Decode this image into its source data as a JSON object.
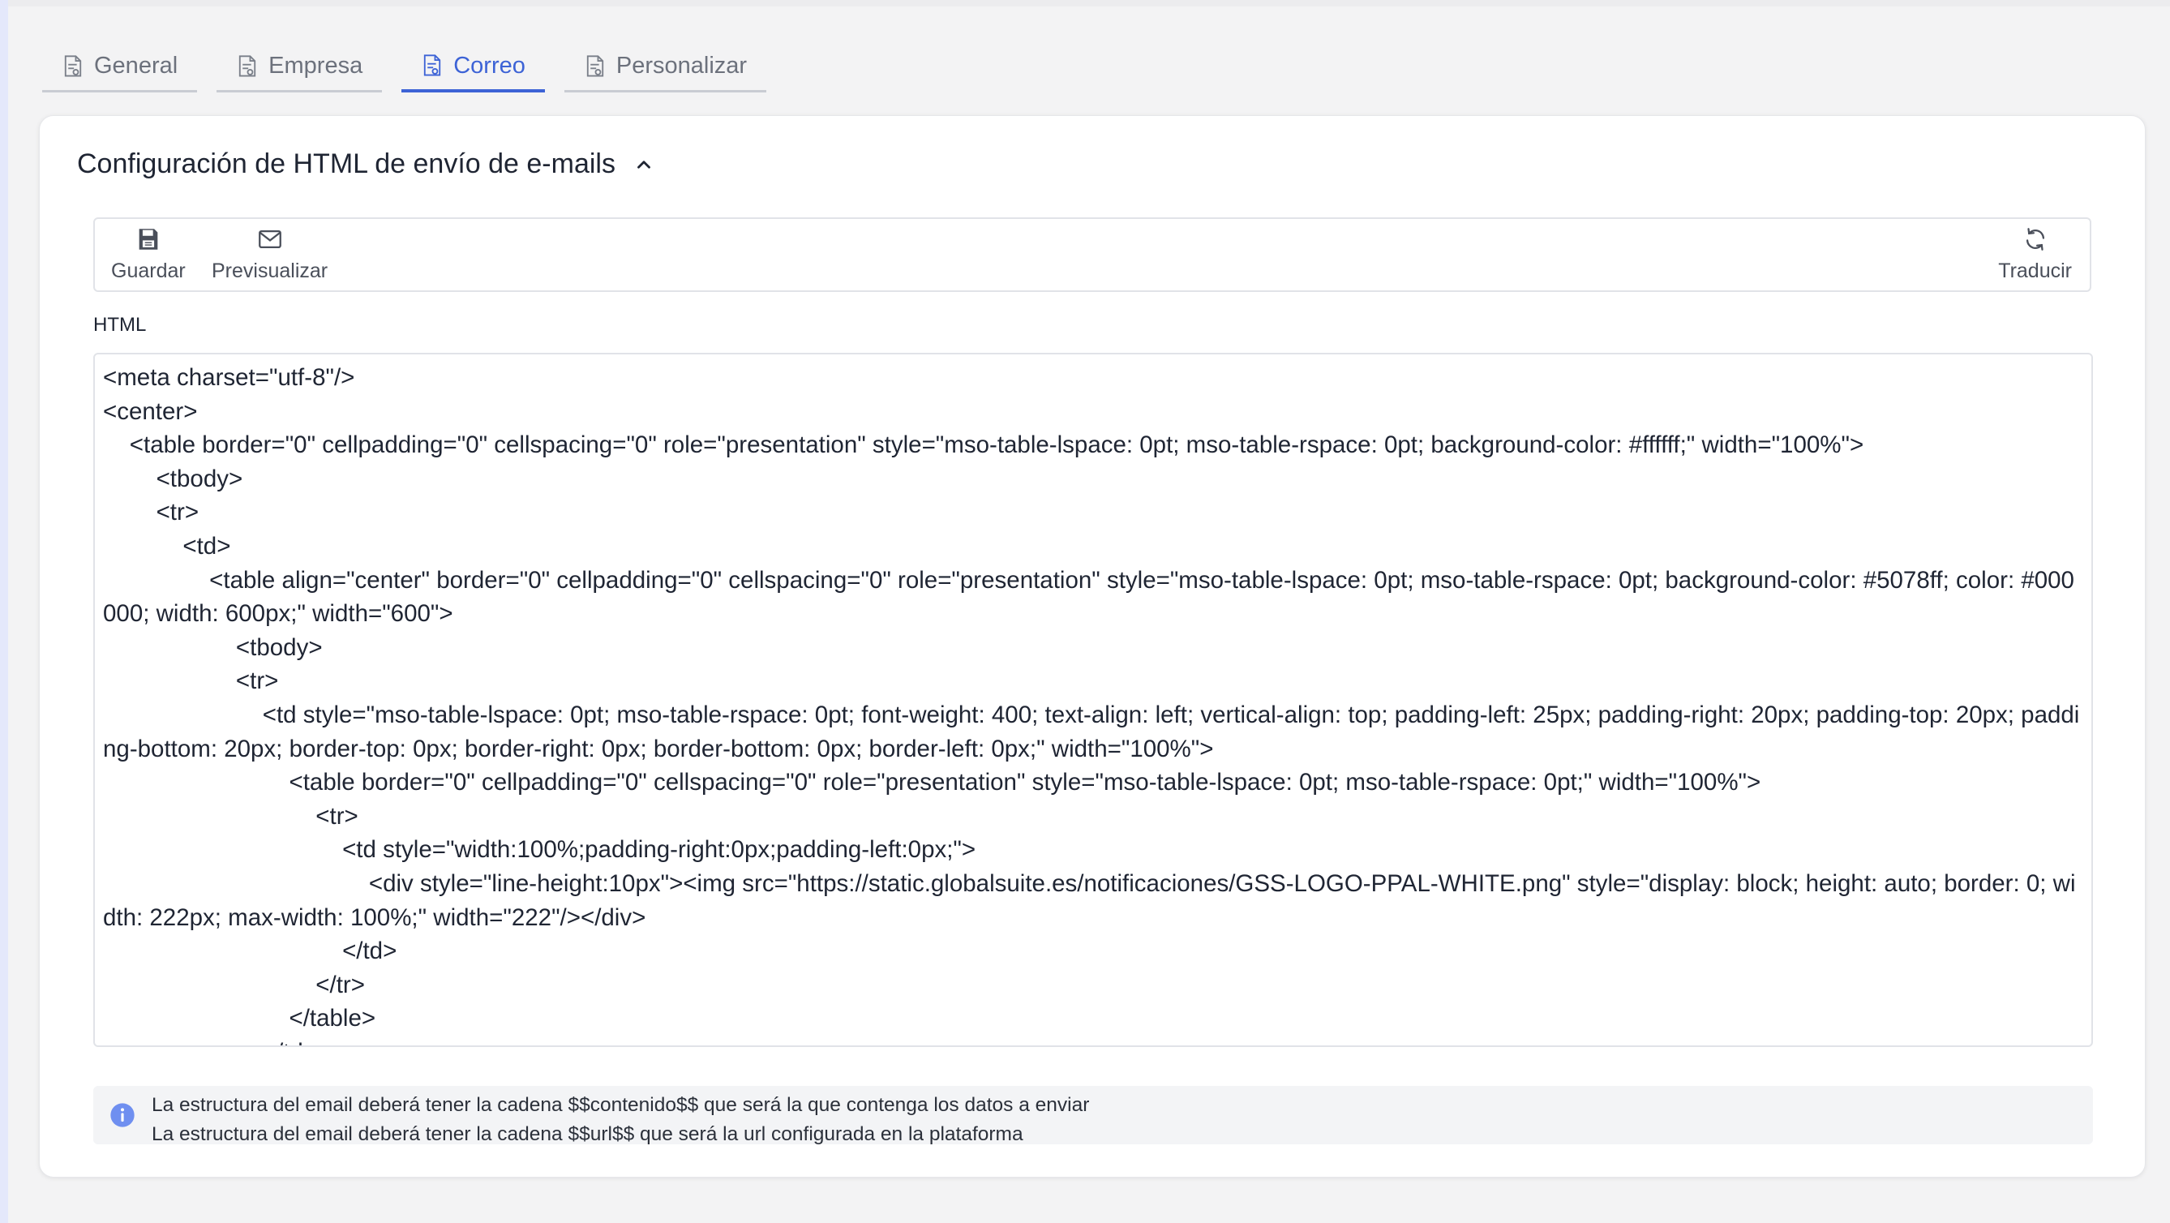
{
  "tabs": [
    {
      "label": "General",
      "icon": "document-icon",
      "active": false
    },
    {
      "label": "Empresa",
      "icon": "document-icon",
      "active": false
    },
    {
      "label": "Correo",
      "icon": "document-icon",
      "active": true
    },
    {
      "label": "Personalizar",
      "icon": "document-icon",
      "active": false
    }
  ],
  "section": {
    "title": "Configuración de HTML de envío de e-mails",
    "collapse_icon": "chevron-up-icon"
  },
  "toolbar": {
    "save_label": "Guardar",
    "save_icon": "floppy-disk-icon",
    "preview_label": "Previsualizar",
    "preview_icon": "envelope-icon",
    "translate_label": "Traducir",
    "translate_icon": "refresh-icon"
  },
  "editor": {
    "label": "HTML",
    "code": "<meta charset=\"utf-8\"/>\n<center>\n    <table border=\"0\" cellpadding=\"0\" cellspacing=\"0\" role=\"presentation\" style=\"mso-table-lspace: 0pt; mso-table-rspace: 0pt; background-color: #ffffff;\" width=\"100%\">\n        <tbody>\n        <tr>\n            <td>\n                <table align=\"center\" border=\"0\" cellpadding=\"0\" cellspacing=\"0\" role=\"presentation\" style=\"mso-table-lspace: 0pt; mso-table-rspace: 0pt; background-color: #5078ff; color: #000000; width: 600px;\" width=\"600\">\n                    <tbody>\n                    <tr>\n                        <td style=\"mso-table-lspace: 0pt; mso-table-rspace: 0pt; font-weight: 400; text-align: left; vertical-align: top; padding-left: 25px; padding-right: 20px; padding-top: 20px; padding-bottom: 20px; border-top: 0px; border-right: 0px; border-bottom: 0px; border-left: 0px;\" width=\"100%\">\n                            <table border=\"0\" cellpadding=\"0\" cellspacing=\"0\" role=\"presentation\" style=\"mso-table-lspace: 0pt; mso-table-rspace: 0pt;\" width=\"100%\">\n                                <tr>\n                                    <td style=\"width:100%;padding-right:0px;padding-left:0px;\">\n                                        <div style=\"line-height:10px\"><img src=\"https://static.globalsuite.es/notificaciones/GSS-LOGO-PPAL-WHITE.png\" style=\"display: block; height: auto; border: 0; width: 222px; max-width: 100%;\" width=\"222\"/></div>\n                                    </td>\n                                </tr>\n                            </table>\n                        </td>"
  },
  "info": {
    "icon": "info-icon",
    "line1": "La estructura del email deberá tener la cadena $$contenido$$ que será la que contenga los datos a enviar",
    "line2": "La estructura del email deberá tener la cadena $$url$$ que será la url configurada en la plataforma"
  },
  "colors": {
    "accent": "#3d63d6",
    "info_icon": "#6f8ff0"
  }
}
